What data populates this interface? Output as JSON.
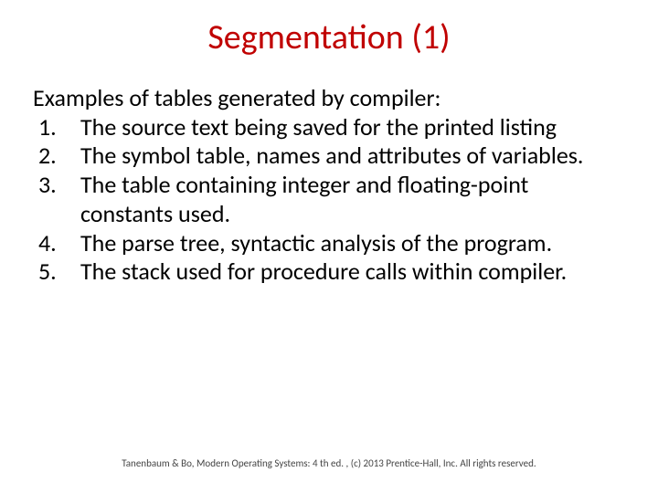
{
  "title": "Segmentation (1)",
  "intro": "Examples of tables generated by compiler:",
  "items": [
    "The source text being saved for the printed listing",
    "The symbol table, names and attributes of variables.",
    "The table containing integer and floating-point constants used.",
    "The parse tree, syntactic analysis of the program.",
    "The stack used for procedure calls within compiler."
  ],
  "footer": "Tanenbaum & Bo, Modern  Operating Systems: 4 th ed. , (c) 2013 Prentice-Hall, Inc. All rights reserved."
}
